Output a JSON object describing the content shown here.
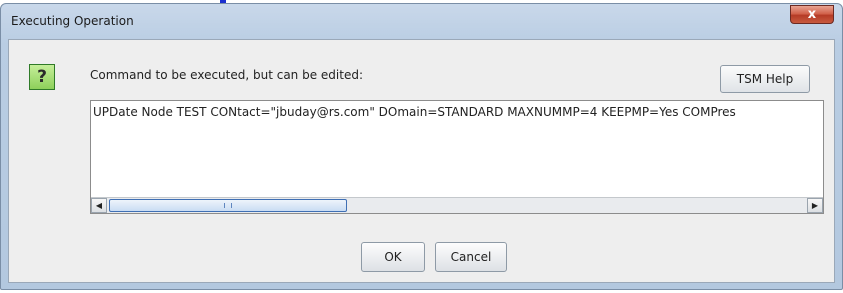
{
  "window": {
    "title": "Executing Operation",
    "close_label": "x"
  },
  "dialog": {
    "icon_glyph": "?",
    "prompt": "Command to be executed, but can be edited:",
    "help_label": "TSM Help",
    "command_text": "UPDate Node TEST CONtact=\"jbuday@rs.com\" DOmain=STANDARD MAXNUMMP=4 KEEPMP=Yes COMPres",
    "ok_label": "OK",
    "cancel_label": "Cancel"
  },
  "scrollbar": {
    "left_arrow": "◀",
    "right_arrow": "▶"
  },
  "colors": {
    "title_bar": "#b9cde3",
    "close_button": "#c85a3f",
    "help_icon_bg": "#8dd05a",
    "scroll_thumb": "#c9dcf3"
  }
}
